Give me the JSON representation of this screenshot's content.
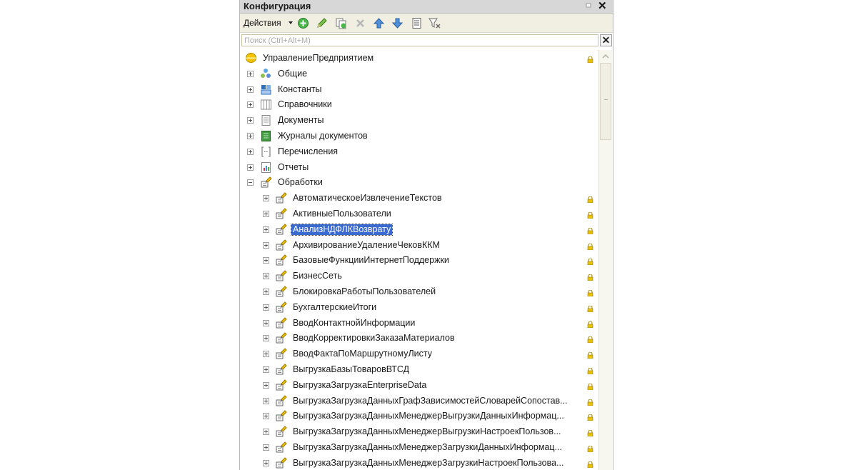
{
  "window": {
    "title": "Конфигурация",
    "close_symbol": "✕"
  },
  "toolbar": {
    "actions_label": "Действия",
    "icons": [
      "add-icon",
      "edit-icon",
      "copy-icon",
      "delete-icon",
      "move-up-icon",
      "move-down-icon",
      "list-icon",
      "filter-icon"
    ]
  },
  "search": {
    "placeholder": "Поиск (Ctrl+Alt+M)",
    "value": "",
    "clear_symbol": "✕"
  },
  "tree": {
    "root": {
      "label": "УправлениеПредприятием",
      "icon": "configuration-icon"
    },
    "groups": [
      {
        "label": "Общие",
        "icon": "common-icon",
        "expanded": false
      },
      {
        "label": "Константы",
        "icon": "constants-icon",
        "expanded": false
      },
      {
        "label": "Справочники",
        "icon": "catalogs-icon",
        "expanded": false
      },
      {
        "label": "Документы",
        "icon": "documents-icon",
        "expanded": false
      },
      {
        "label": "Журналы документов",
        "icon": "journals-icon",
        "expanded": false
      },
      {
        "label": "Перечисления",
        "icon": "enums-icon",
        "expanded": false
      },
      {
        "label": "Отчеты",
        "icon": "reports-icon",
        "expanded": false
      },
      {
        "label": "Обработки",
        "icon": "dataprocessors-icon",
        "expanded": true
      }
    ],
    "processors": [
      "АвтоматическоеИзвлечениеТекстов",
      "АктивныеПользователи",
      "АнализНДФЛКВозврату",
      "АрхивированиеУдалениеЧековККМ",
      "БазовыеФункцииИнтернетПоддержки",
      "БизнесСеть",
      "БлокировкаРаботыПользователей",
      "БухгалтерскиеИтоги",
      "ВводКонтактнойИнформации",
      "ВводКорректировкиЗаказаМатериалов",
      "ВводФактаПоМаршрутномуЛисту",
      "ВыгрузкаБазыТоваровВТСД",
      "ВыгрузкаЗагрузкаEnterpriseData",
      "ВыгрузкаЗагрузкаДанныхГрафЗависимостейСловарейСопостав...",
      "ВыгрузкаЗагрузкаДанныхМенеджерВыгрузкиДанныхИнформац...",
      "ВыгрузкаЗагрузкаДанныхМенеджерВыгрузкиНастроекПользов...",
      "ВыгрузкаЗагрузкаДанныхМенеджерЗагрузкиДанныхИнформац...",
      "ВыгрузкаЗагрузкаДанныхМенеджерЗагрузкиНастроекПользова..."
    ],
    "selected_processor": "АнализНДФЛКВозврату"
  },
  "colors": {
    "selection": "#3a6ad0",
    "lock": "#e8c000",
    "titlebar": "#d7d7d7",
    "toolbar": "#f1efe2"
  }
}
